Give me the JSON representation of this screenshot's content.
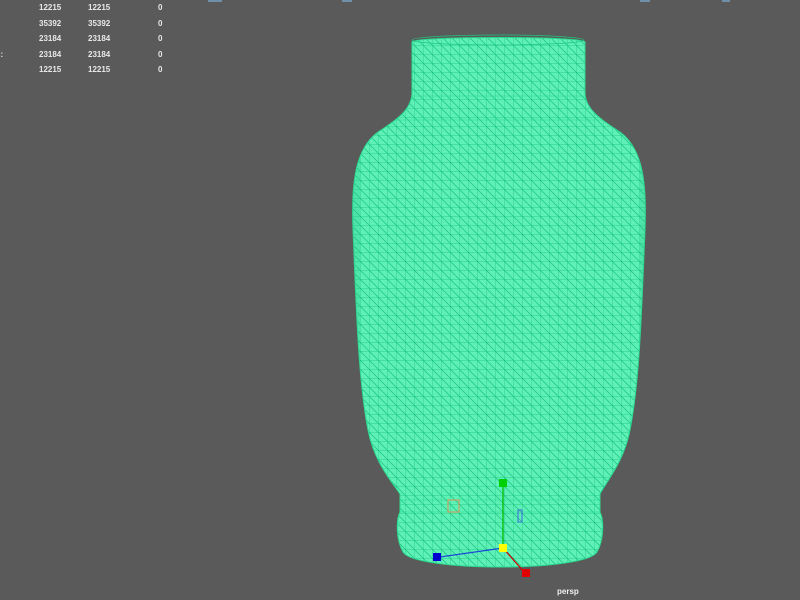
{
  "hud": {
    "rows": [
      {
        "label": "",
        "c1": "12215",
        "c2": "12215",
        "c3": "0"
      },
      {
        "label": "",
        "c1": "35392",
        "c2": "35392",
        "c3": "0"
      },
      {
        "label": "",
        "c1": "23184",
        "c2": "23184",
        "c3": "0"
      },
      {
        "label": "ś:",
        "c1": "23184",
        "c2": "23184",
        "c3": "0"
      },
      {
        "label": "",
        "c1": "12215",
        "c2": "12215",
        "c3": "0"
      }
    ]
  },
  "viewport": {
    "camera_label": "persp",
    "background_color": "#5a5a5a",
    "wireframe_color": "#2fe69a",
    "mesh_fill_color": "#5ff0b8"
  },
  "manipulator": {
    "x_axis_color": "#e00000",
    "y_axis_color": "#00c000",
    "z_axis_color": "#0000d0",
    "center_color": "#ffff00"
  }
}
